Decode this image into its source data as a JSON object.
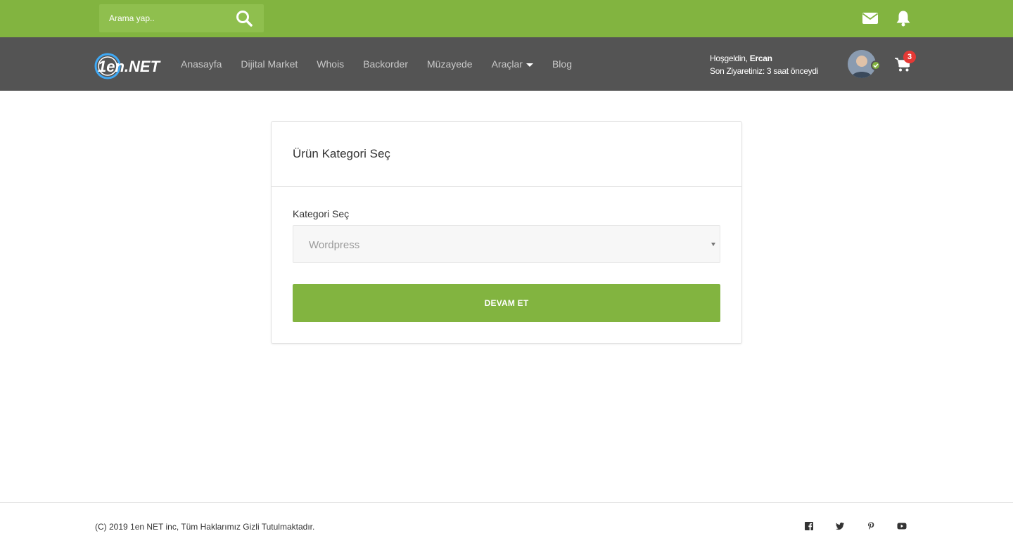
{
  "topbar": {
    "search_placeholder": "Arama yap..",
    "icons": [
      "search-icon",
      "envelope-icon",
      "bell-icon"
    ]
  },
  "navbar": {
    "logo_text": "1en.NET",
    "menu": [
      "Anasayfa",
      "Dijital Market",
      "Whois",
      "Backorder",
      "Müzayede",
      "Araçlar",
      "Blog"
    ],
    "welcome_prefix": "Hoşgeldin,",
    "user_name": "Ercan",
    "last_visit": "Son Ziyaretiniz: 3 saat önceydi",
    "cart_count": "3"
  },
  "card": {
    "title": "Ürün Kategori Seç",
    "field_label": "Kategori Seç",
    "selected_category": "Wordpress",
    "button_label": "DEVAM ET"
  },
  "footer": {
    "copyright": "(C) 2019 1en NET inc, Tüm Haklarımız Gizli Tutulmaktadır.",
    "social_icons": [
      "facebook-icon",
      "twitter-icon",
      "pinterest-icon",
      "youtube-icon"
    ]
  },
  "colors": {
    "brand_green": "#82b440",
    "navbar_gray": "#545454",
    "badge_red": "#e53935"
  }
}
